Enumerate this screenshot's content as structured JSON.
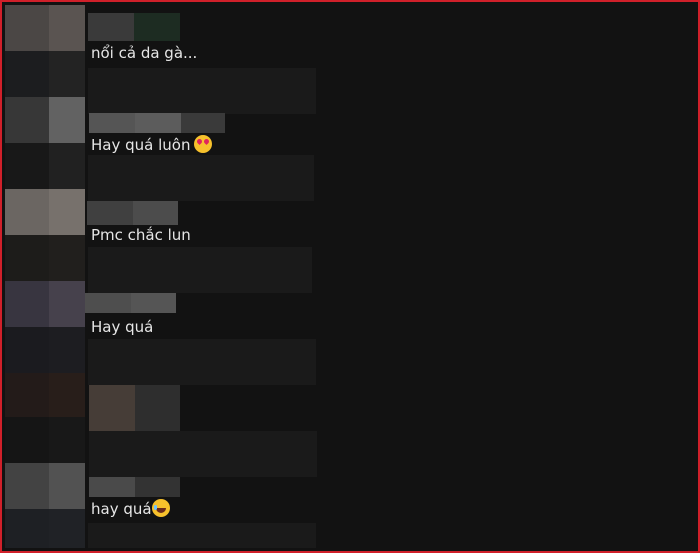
{
  "comments": [
    {
      "text": "nổi cả da gà...",
      "emoji": ""
    },
    {
      "text": "Hay quá luôn",
      "emoji": "heart-eyes-emoji"
    },
    {
      "text": "Pmc chắc lun",
      "emoji": ""
    },
    {
      "text": "Hay quá",
      "emoji": ""
    },
    {
      "text": "",
      "emoji": ""
    },
    {
      "text": "hay quá",
      "emoji": "laughing-emoji"
    }
  ],
  "colors": {
    "background": "#121212",
    "text": "#e6e6e6",
    "frame_border": "#d0202a"
  }
}
